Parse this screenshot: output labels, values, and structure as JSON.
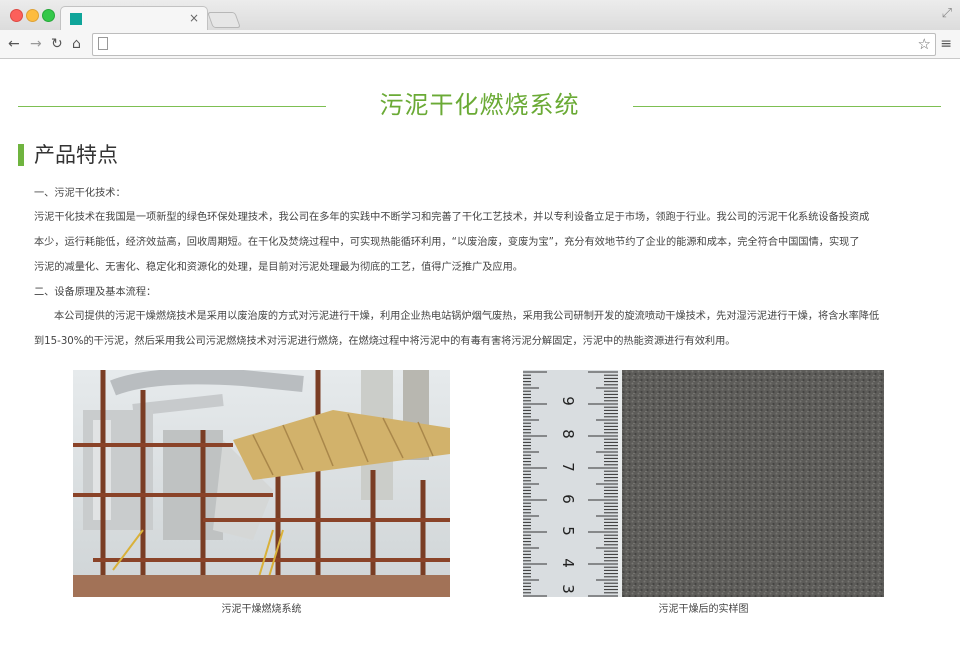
{
  "browser": {
    "tab_close": "×",
    "fullscreen": "⤢",
    "back": "←",
    "forward": "→",
    "reload": "↻",
    "home": "⌂",
    "star": "☆",
    "menu": "≡"
  },
  "page": {
    "title": "污泥干化燃烧系统",
    "section_title": "产品特点",
    "paragraphs": [
      "一、污泥干化技术：",
      "污泥干化技术在我国是一项新型的绿色环保处理技术，我公司在多年的实践中不断学习和完善了干化工艺技术，并以专利设备立足于市场，领跑于行业。我公司的污泥干化系统设备投资成",
      "本少，运行耗能低，经济效益高，回收周期短。在干化及焚烧过程中，可实现热能循环利用，“以废治废，变废为宝”，充分有效地节约了企业的能源和成本，完全符合中国国情，实现了",
      "污泥的减量化、无害化、稳定化和资源化的处理，是目前对污泥处理最为彻底的工艺，值得广泛推广及应用。",
      "二、设备原理及基本流程：",
      "本公司提供的污泥干燥燃烧技术是采用以废治废的方式对污泥进行干燥，利用企业热电站锅炉烟气废热，采用我公司研制开发的旋流喷动干燥技术，先对湿污泥进行干燥，将含水率降低",
      "到15-30%的干污泥，然后采用我公司污泥燃烧技术对污泥进行燃烧，在燃烧过程中将污泥中的有毒有害将污泥分解固定，污泥中的热能资源进行有效利用。"
    ],
    "images": [
      {
        "caption": "污泥干燥燃烧系统"
      },
      {
        "caption": "污泥干燥后的实样图"
      }
    ],
    "ruler_numbers": [
      "9",
      "8",
      "7",
      "6",
      "5",
      "4",
      "3"
    ]
  },
  "colors": {
    "accent": "#6aaa35",
    "rule": "#7dbf52",
    "section_bar": "#6fb43f"
  }
}
